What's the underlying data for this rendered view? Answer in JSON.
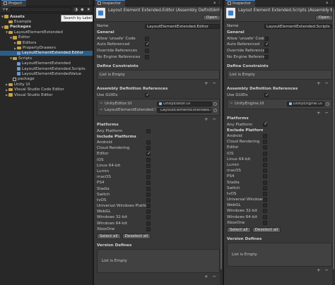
{
  "project": {
    "tab": "Project",
    "tooltip": "Search by Label",
    "tree": [
      {
        "label": "Assets",
        "depth": 0,
        "arrow": "▼",
        "kind": "folder",
        "bold": true
      },
      {
        "label": "Example",
        "depth": 1,
        "arrow": "",
        "kind": "folder"
      },
      {
        "label": "Packages",
        "depth": 0,
        "arrow": "▼",
        "kind": "folder",
        "bold": true
      },
      {
        "label": "LayoutElementExtended",
        "depth": 1,
        "arrow": "▼",
        "kind": "folder"
      },
      {
        "label": "Editor",
        "depth": 2,
        "arrow": "▼",
        "kind": "folder"
      },
      {
        "label": "Editors",
        "depth": 3,
        "arrow": "▶",
        "kind": "folder"
      },
      {
        "label": "PropertyDrawers",
        "depth": 3,
        "arrow": "▶",
        "kind": "folder"
      },
      {
        "label": "LayoutElementExtended.Editor",
        "depth": 3,
        "arrow": "",
        "kind": "asm",
        "selected": true
      },
      {
        "label": "Scripts",
        "depth": 2,
        "arrow": "▼",
        "kind": "folder"
      },
      {
        "label": "LayoutElementExtended",
        "depth": 3,
        "arrow": "",
        "kind": "asm"
      },
      {
        "label": "LayoutElementExtended.Scripts",
        "depth": 3,
        "arrow": "",
        "kind": "asm"
      },
      {
        "label": "LayoutElementExtendedValue",
        "depth": 3,
        "arrow": "",
        "kind": "asm"
      },
      {
        "label": "package",
        "depth": 2,
        "arrow": "",
        "kind": "pkg"
      },
      {
        "label": "Unity UI",
        "depth": 1,
        "arrow": "▶",
        "kind": "folder"
      },
      {
        "label": "Visual Studio Code Editor",
        "depth": 1,
        "arrow": "▶",
        "kind": "folder"
      },
      {
        "label": "Visual Studio Editor",
        "depth": 1,
        "arrow": "▶",
        "kind": "folder"
      }
    ]
  },
  "inspector1": {
    "tab": "Inspector",
    "title": "Layout Element Extended.Editor (Assembly Definition I",
    "open_label": "Open",
    "name_label": "Name",
    "name_value": "LayoutElementExtended.Editor",
    "general_title": "General",
    "general": [
      {
        "label": "Allow 'unsafe' Code",
        "checked": false
      },
      {
        "label": "Auto Referenced",
        "checked": true
      },
      {
        "label": "Override References",
        "checked": false
      },
      {
        "label": "No Engine References",
        "checked": false
      }
    ],
    "constraints_title": "Define Constraints",
    "constraints_empty": "List is Empty",
    "asmref_title": "Assembly Definition References",
    "use_guids_label": "Use GUIDs",
    "use_guids": true,
    "references": [
      {
        "name": "UnityEditor.UI",
        "object": "UnityEditor.UI"
      },
      {
        "name": "LayoutElementExtended.Scripts",
        "object": "LayoutElementExtended.Scripts"
      }
    ],
    "platforms_title": "Platforms",
    "any_platform_label": "Any Platform",
    "any_platform": false,
    "include_label": "Include Platforms",
    "platforms": [
      {
        "label": "Android",
        "checked": false
      },
      {
        "label": "Cloud Rendering",
        "checked": false
      },
      {
        "label": "Editor",
        "checked": true
      },
      {
        "label": "iOS",
        "checked": false
      },
      {
        "label": "Linux 64-bit",
        "checked": false
      },
      {
        "label": "Lumin",
        "checked": false
      },
      {
        "label": "macOS",
        "checked": false
      },
      {
        "label": "PS4",
        "checked": false
      },
      {
        "label": "Stadia",
        "checked": false
      },
      {
        "label": "Switch",
        "checked": false
      },
      {
        "label": "tvOS",
        "checked": false
      },
      {
        "label": "Universal Windows Platform",
        "checked": false
      },
      {
        "label": "WebGL",
        "checked": false
      },
      {
        "label": "Windows 32-bit",
        "checked": false
      },
      {
        "label": "Windows 64-bit",
        "checked": false
      },
      {
        "label": "XboxOne",
        "checked": false
      }
    ],
    "select_all": "Select all",
    "deselect_all": "Deselect all",
    "version_title": "Version Defines",
    "version_empty": "List is Empty"
  },
  "inspector2": {
    "tab": "Inspector",
    "title": "Layout Element Extended.Scripts (Assembly Defin",
    "open_label": "Open",
    "name_label": "Name",
    "name_value": "LayoutElementExtended.Scripts",
    "general_title": "General",
    "general": [
      {
        "label": "Allow 'unsafe' Code",
        "checked": false
      },
      {
        "label": "Auto Referenced",
        "checked": true
      },
      {
        "label": "Override References",
        "checked": false
      },
      {
        "label": "No Engine References",
        "checked": false
      }
    ],
    "constraints_title": "Define Constraints",
    "constraints_empty": "List is Empty",
    "asmref_title": "Assembly Definition References",
    "use_guids_label": "Use GUIDs",
    "use_guids": true,
    "references": [
      {
        "name": "UnityEngine.UI",
        "object": "UnityEngine.UI"
      }
    ],
    "platforms_title": "Platforms",
    "any_platform_label": "Any Platform",
    "any_platform": true,
    "include_label": "Exclude Platforms",
    "platforms": [
      {
        "label": "Android",
        "checked": false
      },
      {
        "label": "Cloud Rendering",
        "checked": false
      },
      {
        "label": "Editor",
        "checked": false
      },
      {
        "label": "iOS",
        "checked": false
      },
      {
        "label": "Linux 64-bit",
        "checked": false
      },
      {
        "label": "Lumin",
        "checked": false
      },
      {
        "label": "macOS",
        "checked": false
      },
      {
        "label": "PS4",
        "checked": false
      },
      {
        "label": "Stadia",
        "checked": false
      },
      {
        "label": "Switch",
        "checked": false
      },
      {
        "label": "tvOS",
        "checked": false
      },
      {
        "label": "Universal Windows Pl",
        "checked": false
      },
      {
        "label": "WebGL",
        "checked": false
      },
      {
        "label": "Windows 32-bit",
        "checked": false
      },
      {
        "label": "Windows 64-bit",
        "checked": false
      },
      {
        "label": "XboxOne",
        "checked": false
      }
    ],
    "select_all": "Select all",
    "deselect_all": "Deselect all",
    "version_title": "Version Defines",
    "version_empty": "List is Empty"
  }
}
